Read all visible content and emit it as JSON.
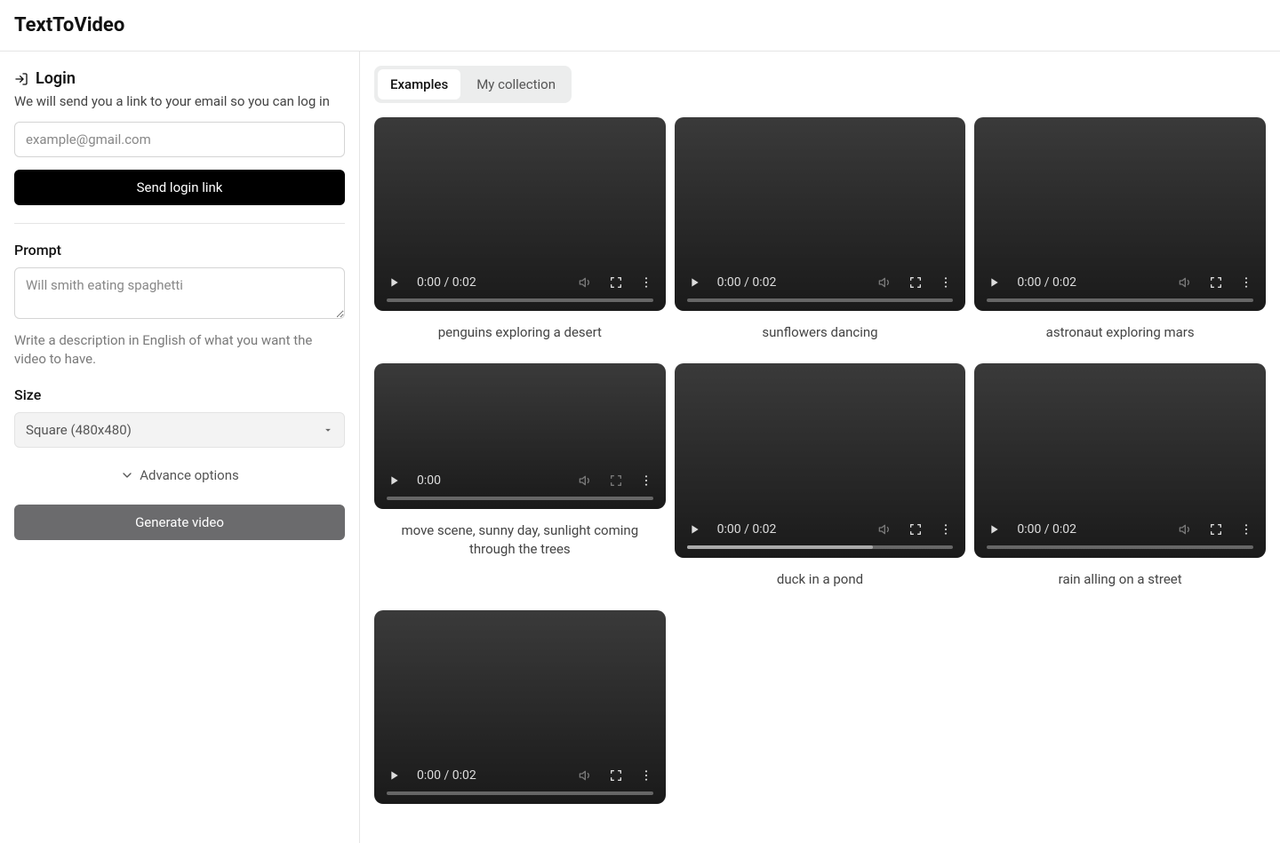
{
  "header": {
    "title": "TextToVideo"
  },
  "login": {
    "title": "Login",
    "desc": "We will send you a link to your email so you can log in",
    "email_placeholder": "example@gmail.com",
    "send_label": "Send login link"
  },
  "prompt": {
    "label": "Prompt",
    "placeholder": "Will smith eating spaghetti",
    "hint": "Write a description in English of what you want the video to have."
  },
  "size": {
    "label": "Size",
    "value": "Square (480x480)"
  },
  "advance_label": "Advance options",
  "generate_label": "Generate video",
  "tabs": {
    "examples": "Examples",
    "my_collection": "My collection"
  },
  "videos": [
    {
      "time": "0:00 / 0:02",
      "caption": "penguins exploring a desert",
      "shape": "full",
      "fs_dim": false,
      "buffered": false
    },
    {
      "time": "0:00 / 0:02",
      "caption": "sunflowers dancing",
      "shape": "full",
      "fs_dim": false,
      "buffered": false
    },
    {
      "time": "0:00 / 0:02",
      "caption": "astronaut exploring mars",
      "shape": "full",
      "fs_dim": false,
      "buffered": false
    },
    {
      "time": "0:00",
      "caption": "move scene, sunny day, sunlight coming through the trees",
      "shape": "short",
      "fs_dim": true,
      "buffered": false
    },
    {
      "time": "0:00 / 0:02",
      "caption": "duck in a pond",
      "shape": "full",
      "fs_dim": false,
      "buffered": true
    },
    {
      "time": "0:00 / 0:02",
      "caption": "rain alling on a street",
      "shape": "full",
      "fs_dim": false,
      "buffered": false
    },
    {
      "time": "0:00 / 0:02",
      "caption": "",
      "shape": "full",
      "fs_dim": false,
      "buffered": false
    }
  ]
}
